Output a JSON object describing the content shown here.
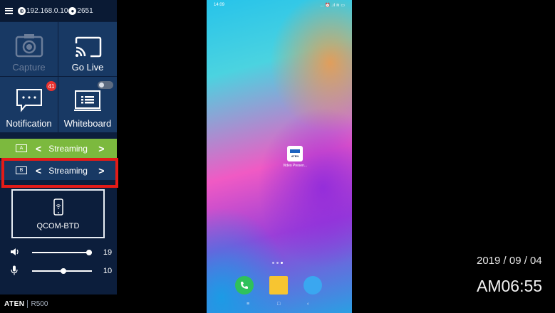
{
  "topbar": {
    "ip": "192.168.0.10",
    "port": "2651"
  },
  "tiles": {
    "capture_label": "Capture",
    "golive_label": "Go Live",
    "notification_label": "Notification",
    "notification_badge": "41",
    "whiteboard_label": "Whiteboard",
    "whiteboard_toggle_on": false
  },
  "streams": [
    {
      "channel": "A",
      "label": "Streaming",
      "active": true
    },
    {
      "channel": "B",
      "label": "Streaming",
      "active": false
    }
  ],
  "device": {
    "name": "QCOM-BTD"
  },
  "sliders": {
    "volume": {
      "value": "19",
      "level": 1.0
    },
    "mic": {
      "value": "10",
      "level": 0.53
    }
  },
  "footer": {
    "brand": "ATEN",
    "model": "R500"
  },
  "phone": {
    "status_time": "14:09",
    "status_icons": "... ⏰ .ıl ≋ ▭",
    "app_brand": "ATEN",
    "app_label": "Video Presen..."
  },
  "clock": {
    "date": "2019 / 09 / 04",
    "time": "AM06:55"
  },
  "colors": {
    "panel_bg": "#0c1e3c",
    "tile_bg": "#183964",
    "stream_active": "#7cb93e",
    "highlight": "#e41b17"
  }
}
